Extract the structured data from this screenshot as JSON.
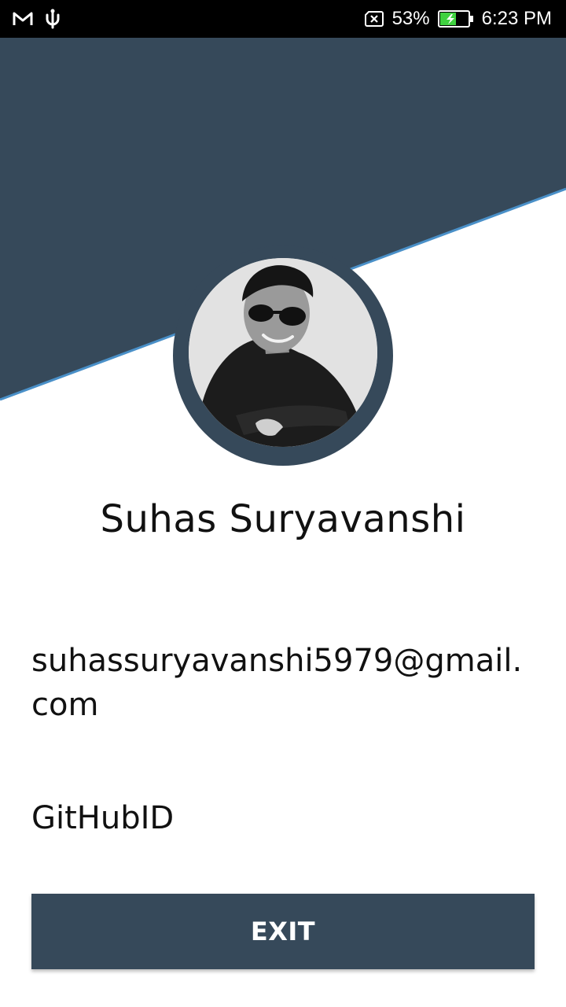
{
  "status_bar": {
    "battery_percent": "53%",
    "time": "6:23 PM",
    "icons": [
      "gmail-icon",
      "usb-icon",
      "no-sim-icon",
      "battery-charging-icon"
    ]
  },
  "theme": {
    "header_color": "#36495a",
    "accent_line": "#4a90c8",
    "background": "#ffffff"
  },
  "profile": {
    "avatar_icon": "profile-photo",
    "name": "Suhas Suryavanshi",
    "email": "suhassuryavanshi5979@gmail.com",
    "github": "GitHubID"
  },
  "actions": {
    "exit_label": "EXIT"
  }
}
